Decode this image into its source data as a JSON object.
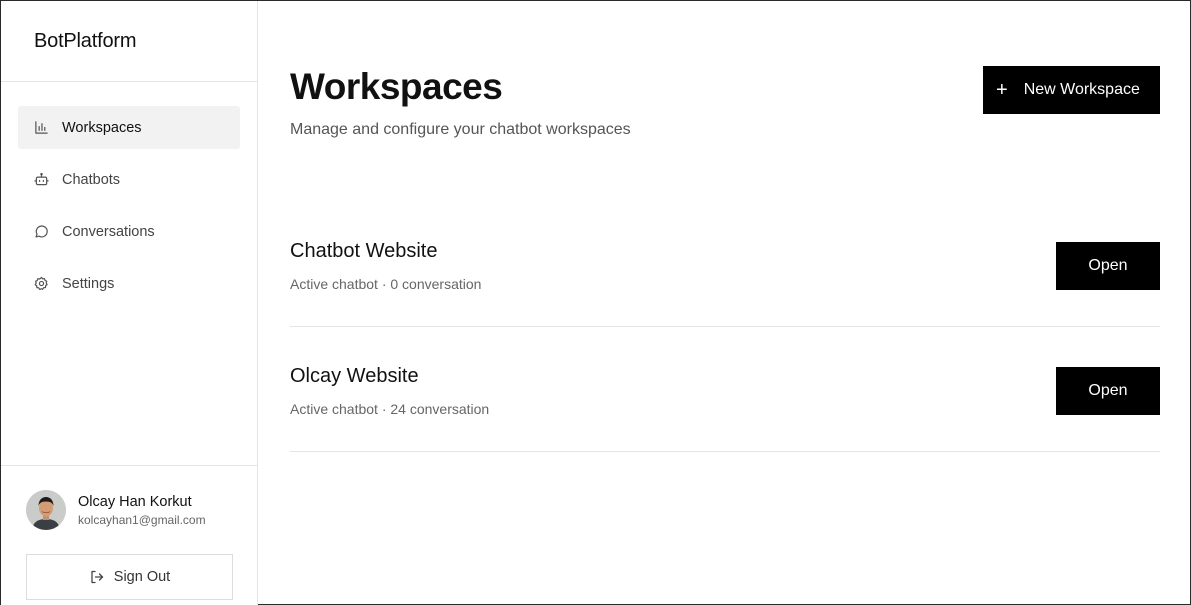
{
  "brand": {
    "name": "BotPlatform"
  },
  "sidebar": {
    "items": [
      {
        "label": "Workspaces",
        "icon": "bar-chart-icon",
        "active": true
      },
      {
        "label": "Chatbots",
        "icon": "bot-icon",
        "active": false
      },
      {
        "label": "Conversations",
        "icon": "message-circle-icon",
        "active": false
      },
      {
        "label": "Settings",
        "icon": "gear-icon",
        "active": false
      }
    ]
  },
  "user": {
    "name": "Olcay Han Korkut",
    "email": "kolcayhan1@gmail.com",
    "signout_label": "Sign Out"
  },
  "main": {
    "title": "Workspaces",
    "subtitle": "Manage and configure your chatbot workspaces",
    "new_button_label": "New Workspace",
    "workspaces": [
      {
        "name": "Chatbot Website",
        "meta": "Active chatbot · 0 conversation",
        "open_label": "Open"
      },
      {
        "name": "Olcay Website",
        "meta": "Active chatbot · 24 conversation",
        "open_label": "Open"
      }
    ]
  },
  "colors": {
    "accent": "#000000",
    "active_nav_bg": "#f2f2f2",
    "border": "#e5e5e5"
  }
}
